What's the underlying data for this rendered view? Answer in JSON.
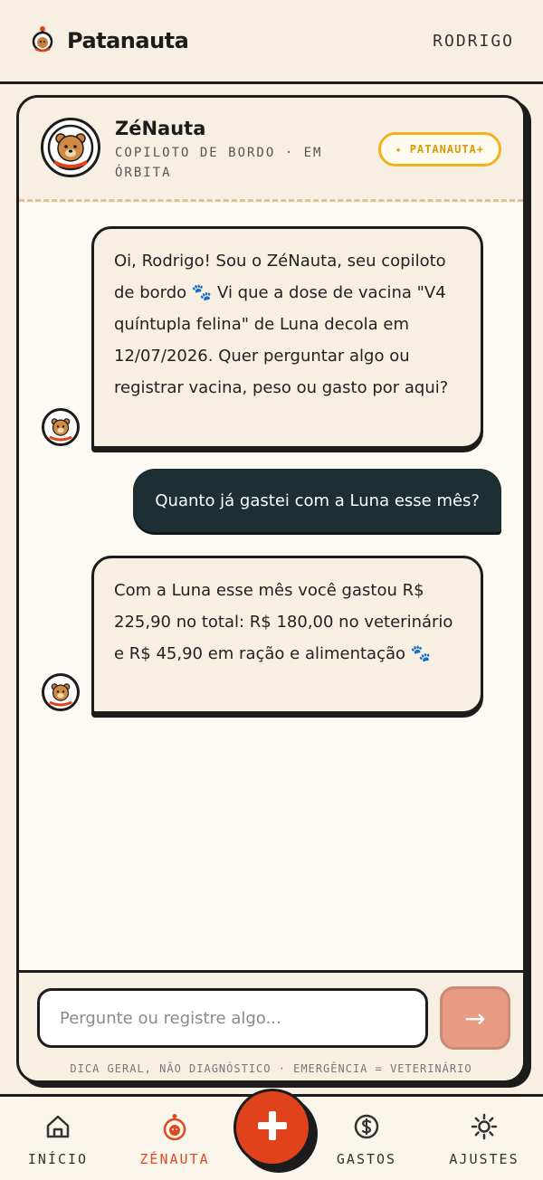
{
  "header": {
    "brand": "Patanauta",
    "user": "RODRIGO"
  },
  "chat": {
    "bot_name": "ZéNauta",
    "bot_subtitle": "COPILOTO DE BORDO · EM ÓRBITA",
    "badge_label": "PATANAUTA+",
    "messages": [
      {
        "from": "bot",
        "text": "Oi, Rodrigo! Sou o ZéNauta, seu copiloto de bordo 🐾 Vi que a dose de vacina \"V4 quíntupla felina\" de Luna decola em 12/07/2026. Quer perguntar algo ou registrar vacina, peso ou gasto por aqui?"
      },
      {
        "from": "user",
        "text": "Quanto já gastei com a Luna esse mês?"
      },
      {
        "from": "bot",
        "text": "Com a Luna esse mês você gastou R$ 225,90 no total: R$ 180,00 no veterinário e R$ 45,90 em ração e alimentação 🐾"
      }
    ],
    "input_placeholder": "Pergunte ou registre algo...",
    "send_icon": "→",
    "disclaimer": "DICA GERAL, NÃO DIAGNÓSTICO · EMERGÊNCIA = VETERINÁRIO"
  },
  "nav": {
    "items": [
      {
        "label": "INÍCIO",
        "icon": "home-icon"
      },
      {
        "label": "ZÉNAUTA",
        "icon": "bot-icon",
        "active": true
      },
      {
        "label": "GASTOS",
        "icon": "coin-icon"
      },
      {
        "label": "AJUSTES",
        "icon": "gear-icon"
      }
    ],
    "fab_icon": "plus-icon"
  },
  "colors": {
    "accent": "#e0421c",
    "badge": "#f2b21c",
    "user_bubble": "#1d2f33",
    "background": "#f6efe2"
  }
}
